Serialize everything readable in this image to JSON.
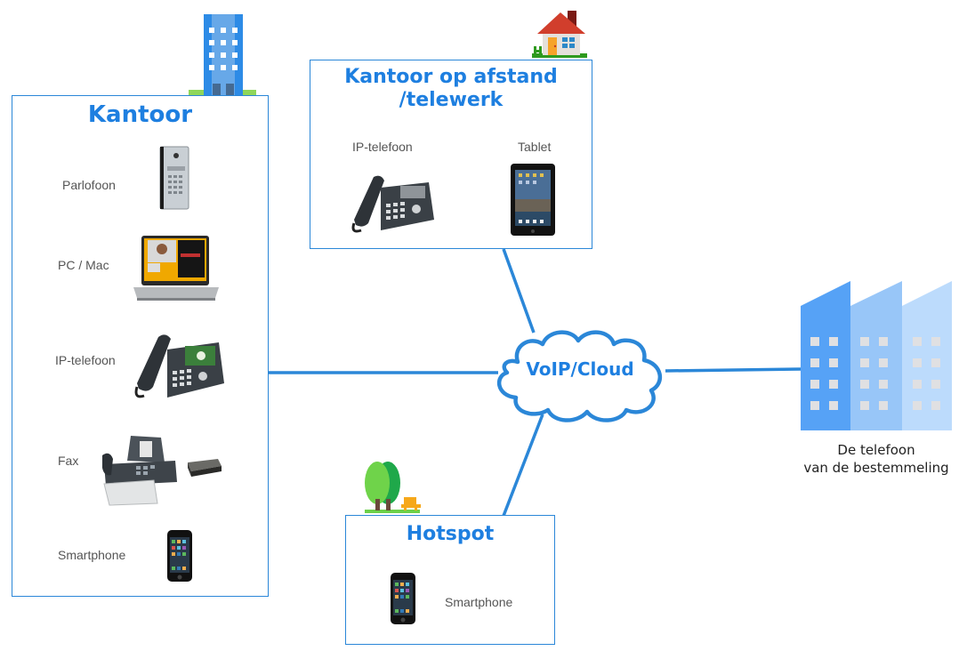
{
  "diagram": {
    "colors": {
      "accent": "#1e7fe0",
      "line": "#2b87d8",
      "label_text": "#555555"
    },
    "cloud": {
      "label": "VoIP/Cloud",
      "icon": "cloud-icon"
    },
    "office": {
      "title": "Kantoor",
      "icon": "office-building-icon",
      "devices": [
        {
          "label": "Parlofoon",
          "icon": "door-intercom-icon"
        },
        {
          "label": "PC / Mac",
          "icon": "laptop-icon"
        },
        {
          "label": "IP-telefoon",
          "icon": "ip-desk-phone-icon"
        },
        {
          "label": "Fax",
          "icon": "fax-machine-icon"
        },
        {
          "label": "Smartphone",
          "icon": "smartphone-icon"
        }
      ]
    },
    "remote": {
      "title": "Kantoor op afstand /telewerk",
      "title_line1": "Kantoor op afstand",
      "title_line2": "/telewerk",
      "icon": "house-icon",
      "devices": [
        {
          "label": "IP-telefoon",
          "icon": "ip-desk-phone-icon"
        },
        {
          "label": "Tablet",
          "icon": "tablet-icon"
        }
      ]
    },
    "hotspot": {
      "title": "Hotspot",
      "icon": "park-trees-icon",
      "devices": [
        {
          "label": "Smartphone",
          "icon": "smartphone-icon"
        }
      ]
    },
    "destination": {
      "line1": "De telefoon",
      "line2": "van de bestemmeling",
      "icon": "destination-buildings-icon"
    }
  }
}
